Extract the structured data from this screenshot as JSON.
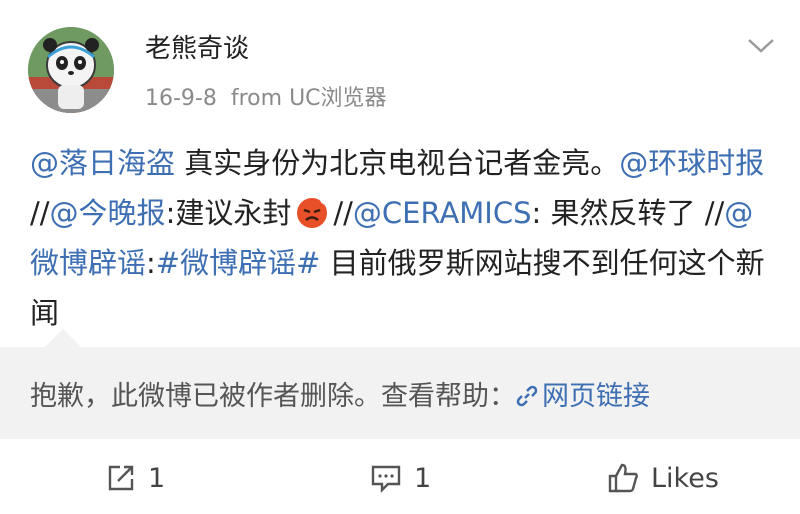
{
  "post": {
    "username": "老熊奇谈",
    "date": "16-9-8",
    "source": "from UC浏览器"
  },
  "content": {
    "mention1": "@落日海盗",
    "text1": " 真实身份为北京电视台记者金亮。",
    "mention2": "@环球时报",
    "sep1": " //",
    "mention3": "@今晚报",
    "text2": ":建议永封",
    "sep2": "//",
    "mention4": "@CERAMICS",
    "text3": ": 果然反转了 //",
    "mention5": "@微博辟谣",
    "text4": ":",
    "hashtag": "#微博辟谣#",
    "text5": " 目前俄罗斯网站搜不到任何这个新闻"
  },
  "repost": {
    "deleted_text": "抱歉，此微博已被作者删除。查看帮助：",
    "link_label": "网页链接"
  },
  "actions": {
    "repost_count": "1",
    "comment_count": "1",
    "like_label": "Likes"
  },
  "colors": {
    "link": "#3e6fb3",
    "repost_bg": "#f2f2f2",
    "meta": "#8a8a8a"
  }
}
